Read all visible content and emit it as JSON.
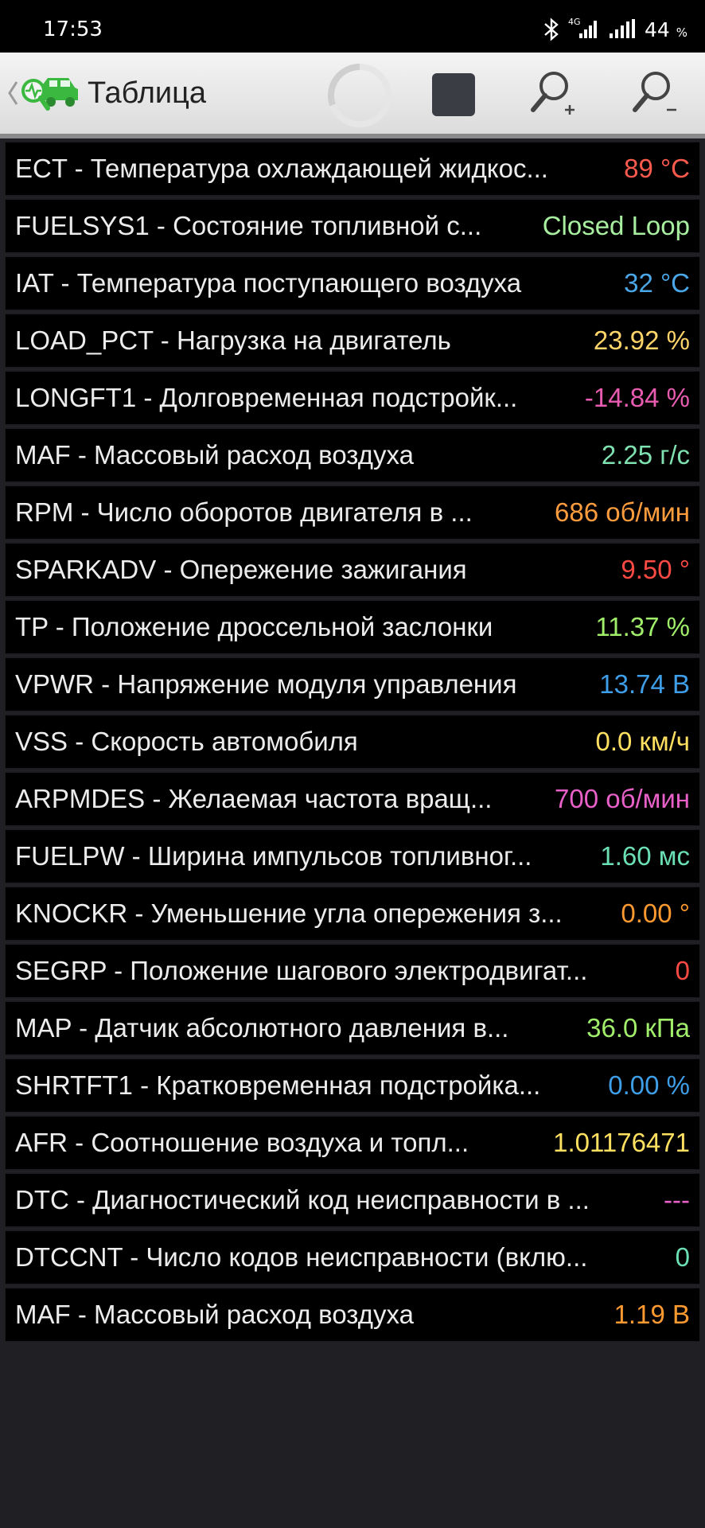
{
  "status_bar": {
    "time": "17:53",
    "network_label": "4G",
    "battery_value": "44",
    "battery_unit": "%"
  },
  "app_bar": {
    "title": "Таблица",
    "icons": [
      "back-chevron-icon",
      "car-diagnostics-logo",
      "loading-spinner-icon",
      "stop-icon",
      "zoom-in-icon",
      "zoom-out-icon"
    ]
  },
  "rows": [
    {
      "label": "ECT - Температура охлаждающей жидкос...",
      "value": "89 °C",
      "color": "#ff5a4e"
    },
    {
      "label": "FUELSYS1 - Состояние топливной с...",
      "value": "Closed Loop",
      "color": "#a8f0a0"
    },
    {
      "label": "IAT - Температура поступающего воздуха",
      "value": "32 °C",
      "color": "#4aa8e8"
    },
    {
      "label": "LOAD_PCT - Нагрузка на двигатель",
      "value": "23.92 %",
      "color": "#ffd56a"
    },
    {
      "label": "LONGFT1 - Долговременная подстройк...",
      "value": "-14.84 %",
      "color": "#e85cb0"
    },
    {
      "label": "MAF - Массовый расход воздуха",
      "value": "2.25 г/с",
      "color": "#7fe0b0"
    },
    {
      "label": "RPM - Число оборотов двигателя в ...",
      "value": "686 об/мин",
      "color": "#ff9d3e"
    },
    {
      "label": "SPARKADV - Опережение зажигания",
      "value": "9.50 °",
      "color": "#ff4a44"
    },
    {
      "label": "TP - Положение дроссельной заслонки",
      "value": "11.37 %",
      "color": "#a0ee6a"
    },
    {
      "label": "VPWR - Напряжение модуля управления",
      "value": "13.74 В",
      "color": "#3e9ee8"
    },
    {
      "label": "VSS - Скорость автомобиля",
      "value": "0.0 км/ч",
      "color": "#ffe060"
    },
    {
      "label": "ARPMDES - Желаемая частота вращ...",
      "value": "700 об/мин",
      "color": "#e860c8"
    },
    {
      "label": "FUELPW - Ширина импульсов топливног...",
      "value": "1.60 мс",
      "color": "#6ae0b4"
    },
    {
      "label": "KNOCKR - Уменьшение угла опережения з...",
      "value": "0.00 °",
      "color": "#ff9a30"
    },
    {
      "label": "SEGRP - Положение шагового электродвигат...",
      "value": "0",
      "color": "#ff4a44"
    },
    {
      "label": "MAP - Датчик абсолютного давления в...",
      "value": "36.0 кПа",
      "color": "#a0ee6a"
    },
    {
      "label": "SHRTFT1 - Кратковременная подстройка...",
      "value": "0.00 %",
      "color": "#3e9ee8"
    },
    {
      "label": "AFR - Соотношение воздуха и топл...",
      "value": "1.01176471",
      "color": "#ffe060"
    },
    {
      "label": "DTC - Диагностический код неисправности в ...",
      "value": "---",
      "color": "#e860c8"
    },
    {
      "label": "DTCCNT - Число кодов неисправности (вклю...",
      "value": "0",
      "color": "#6ae0b4"
    },
    {
      "label": "MAF - Массовый расход воздуха",
      "value": "1.19 В",
      "color": "#ff9a30"
    }
  ]
}
